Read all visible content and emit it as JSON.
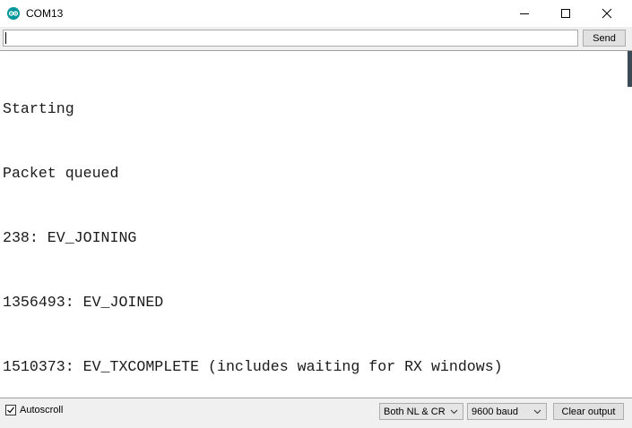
{
  "window": {
    "title": "COM13",
    "icon": "arduino-icon",
    "controls": [
      "minimize-icon",
      "maximize-icon",
      "close-icon"
    ]
  },
  "send_row": {
    "input_value": "",
    "send_label": "Send"
  },
  "output": {
    "lines": [
      "Starting",
      "Packet queued",
      "238: EV_JOINING",
      "1356493: EV_JOINED",
      "1510373: EV_TXCOMPLETE (includes waiting for RX windows)"
    ]
  },
  "bottom_bar": {
    "autoscroll_label": "Autoscroll",
    "autoscroll_checked": true,
    "line_ending": "Both NL & CR",
    "baud_rate": "9600 baud",
    "clear_label": "Clear output"
  },
  "colors": {
    "arduino_teal": "#00979c",
    "toolbar_bg": "#f0f0f0",
    "button_bg": "#e1e1e1"
  }
}
